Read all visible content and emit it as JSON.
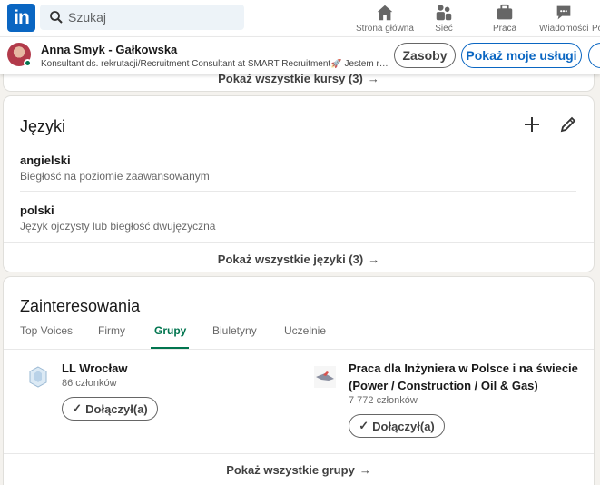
{
  "nav": {
    "logo_text": "in",
    "search_placeholder": "Szukaj",
    "items": [
      {
        "label": "Strona główna",
        "icon": "home-icon"
      },
      {
        "label": "Sieć",
        "icon": "network-icon"
      },
      {
        "label": "Praca",
        "icon": "briefcase-icon"
      },
      {
        "label": "Wiadomości",
        "icon": "messaging-icon"
      },
      {
        "label": "Po",
        "icon": "notifications-icon"
      }
    ]
  },
  "profile_bar": {
    "name": "Anna Smyk - Gałkowska",
    "headline": "Konsultant ds. rekrutacji/Recruitment Consultant at SMART Recruitment🚀 Jestem rekrutem...",
    "resources_button": "Zasoby",
    "services_button": "Pokaż moje usługi"
  },
  "courses": {
    "show_all": "Pokaż wszystkie kursy (3)"
  },
  "languages": {
    "title": "Języki",
    "items": [
      {
        "name": "angielski",
        "proficiency": "Biegłość na poziomie zaawansowanym"
      },
      {
        "name": "polski",
        "proficiency": "Język ojczysty lub biegłość dwujęzyczna"
      }
    ],
    "show_all": "Pokaż wszystkie języki (3)"
  },
  "interests": {
    "title": "Zainteresowania",
    "tabs": [
      "Top Voices",
      "Firmy",
      "Grupy",
      "Biuletyny",
      "Uczelnie"
    ],
    "active_tab": "Grupy",
    "groups": [
      {
        "name": "LL Wrocław",
        "members": "86 członków",
        "button": "Dołączył(a)"
      },
      {
        "name": "Praca dla Inżyniera w Polsce i na świecie (Power / Construction / Oil & Gas)",
        "members": "7 772 członków",
        "button": "Dołączył(a)"
      }
    ],
    "show_all": "Pokaż wszystkie grupy"
  },
  "colors": {
    "brand": "#0a66c2",
    "active_tab": "#01754f",
    "background": "#f4f2ee"
  }
}
